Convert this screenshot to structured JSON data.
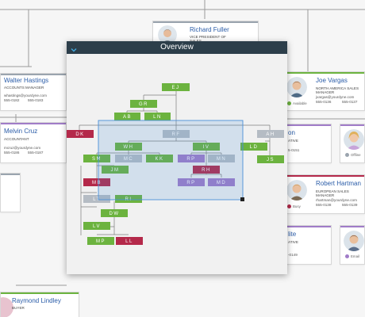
{
  "cards": [
    {
      "key": "richard_fuller",
      "name": "Richard Fuller",
      "title_lines": [
        "VICE PRESIDENT OF",
        "SALES"
      ],
      "email": "",
      "phone1": "",
      "phone2": "",
      "status": "",
      "status_color": "",
      "accent": "#9aa4ae"
    },
    {
      "key": "walter_hastings",
      "name": "Walter Hastings",
      "title_lines": [
        "ACCOUNTS MANAGER"
      ],
      "email": "whastings@yourdyne.com",
      "phone1": "555-0182",
      "phone2": "555-0183",
      "status": "",
      "status_color": "",
      "accent": "#9aa4ae"
    },
    {
      "key": "joe_vargas",
      "name": "Joe Vargas",
      "title_lines": [
        "NORTH AMERICA SALES",
        "MANAGER"
      ],
      "email": "jvargas@yourdyne.com",
      "phone1": "555-0136",
      "phone2": "555-0137",
      "status": "Available",
      "status_color": "#6cb33f",
      "accent": "#6cb33f"
    },
    {
      "key": "melvin_cruz",
      "name": "Melvin Cruz",
      "title_lines": [
        "ACCOUNTANT"
      ],
      "email": "mcruz@yourdyne.com",
      "phone1": "555-0186",
      "phone2": "555-0187",
      "status": "",
      "status_color": "",
      "accent": "#a07cc8"
    },
    {
      "key": "partial_on",
      "name": "on",
      "title_lines": [
        "ATIVE"
      ],
      "email": "",
      "phone1": "5-0151",
      "phone2": "",
      "status": "",
      "status_color": "",
      "accent": "#a07cc8"
    },
    {
      "key": "offline_card",
      "name": "",
      "title_lines": [],
      "email": "",
      "phone1": "",
      "phone2": "",
      "status": "Offline",
      "status_color": "#9aa4ae",
      "accent": "#a07cc8"
    },
    {
      "key": "robert_hartman",
      "name": "Robert Hartman",
      "title_lines": [
        "EUROPEAN SALES",
        "MANAGER"
      ],
      "email": "rhartman@yourdyne.com",
      "phone1": "555-0138",
      "phone2": "555-0139",
      "status": "Busy",
      "status_color": "#b4294a",
      "accent": "#b4294a"
    },
    {
      "key": "partial_lite",
      "name": "lite",
      "title_lines": [
        "ATIVE"
      ],
      "email": "",
      "phone1": "-0149",
      "phone2": "",
      "status": "",
      "status_color": "",
      "accent": "#a07cc8"
    },
    {
      "key": "email_card",
      "name": "",
      "title_lines": [],
      "email": "",
      "phone1": "",
      "phone2": "",
      "status": "Email",
      "status_color": "#a07cc8",
      "accent": "#a07cc8"
    },
    {
      "key": "raymond_lindley",
      "name": "Raymond Lindley",
      "title_lines": [
        "BUYER"
      ],
      "email": "",
      "phone1": "",
      "phone2": "",
      "status": "",
      "status_color": "",
      "accent": "#6cb33f"
    }
  ],
  "overview": {
    "title": "Overview",
    "collapse_icon": "chevron-down-icon",
    "nodes": [
      {
        "label": "EJ",
        "color": "#6cb33f"
      },
      {
        "label": "GR",
        "color": "#6cb33f"
      },
      {
        "label": "AB",
        "color": "#6cb33f"
      },
      {
        "label": "LN",
        "color": "#6cb33f"
      },
      {
        "label": "DK",
        "color": "#b4294a"
      },
      {
        "label": "RF",
        "color": "#b5bcc4"
      },
      {
        "label": "AH",
        "color": "#b5bcc4"
      },
      {
        "label": "WH",
        "color": "#6cb33f"
      },
      {
        "label": "IV",
        "color": "#6cb33f"
      },
      {
        "label": "LD",
        "color": "#6cb33f"
      },
      {
        "label": "SM",
        "color": "#6cb33f"
      },
      {
        "label": "MC",
        "color": "#b5bcc4"
      },
      {
        "label": "KK",
        "color": "#6cb33f"
      },
      {
        "label": "RP",
        "color": "#a07cc8"
      },
      {
        "label": "MN",
        "color": "#b5bcc4"
      },
      {
        "label": "JS",
        "color": "#6cb33f"
      },
      {
        "label": "JM",
        "color": "#6cb33f"
      },
      {
        "label": "RH",
        "color": "#b4294a"
      },
      {
        "label": "MB",
        "color": "#b4294a"
      },
      {
        "label": "RP",
        "color": "#a07cc8"
      },
      {
        "label": "MD",
        "color": "#a07cc8"
      },
      {
        "label": "LT",
        "color": "#b5bcc4"
      },
      {
        "label": "RI",
        "color": "#6cb33f"
      },
      {
        "label": "DW",
        "color": "#6cb33f"
      },
      {
        "label": "LV",
        "color": "#6cb33f"
      },
      {
        "label": "MP",
        "color": "#6cb33f"
      },
      {
        "label": "LL",
        "color": "#b4294a"
      }
    ]
  }
}
